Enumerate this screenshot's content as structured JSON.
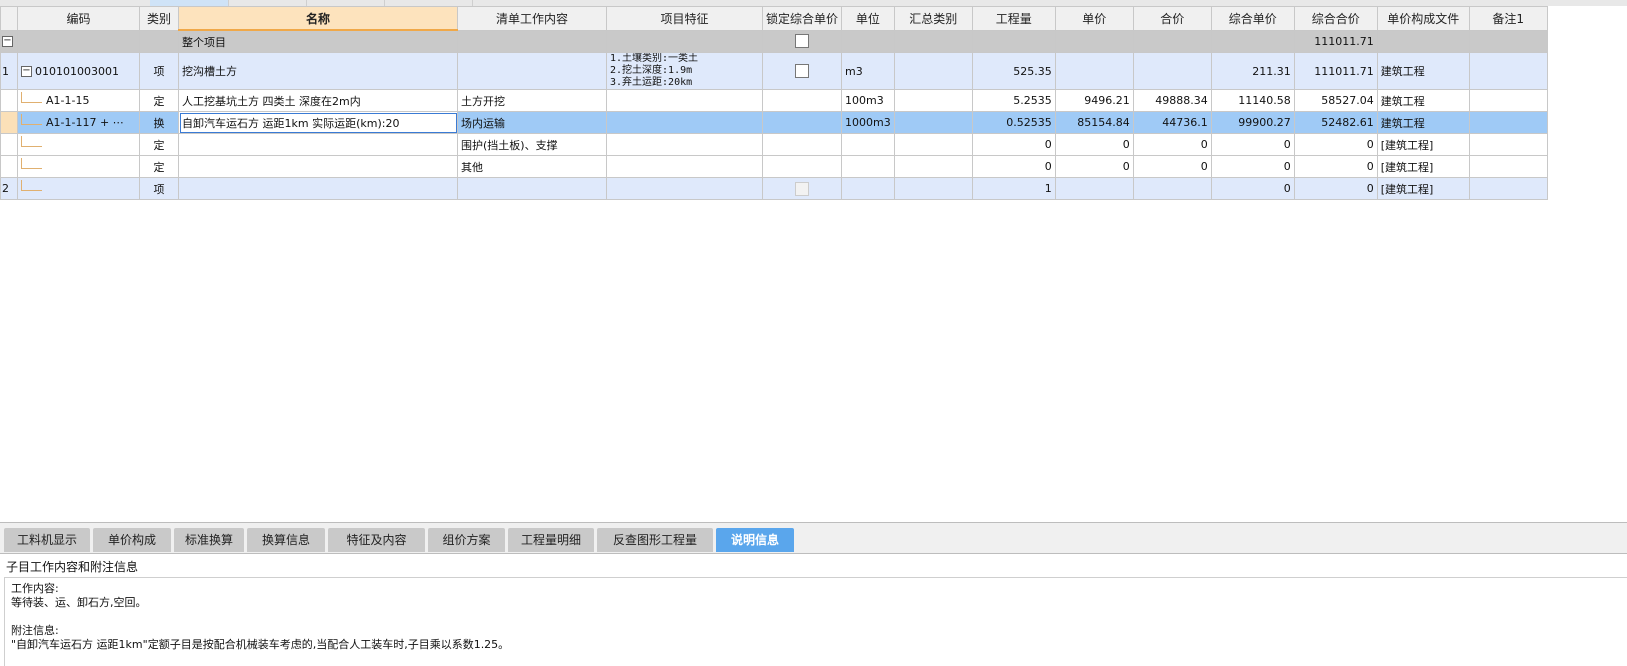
{
  "window": {
    "accent_color": "#5aa6ec",
    "selected_row_color": "#9fcaf6"
  },
  "table": {
    "headers": [
      "",
      "编码",
      "类别",
      "名称",
      "清单工作内容",
      "项目特征",
      "锁定综合单价",
      "单位",
      "汇总类别",
      "工程量",
      "单价",
      "合价",
      "综合单价",
      "综合合价",
      "单价构成文件",
      "备注1"
    ],
    "summary_row": {
      "name": "整个项目",
      "total": "111011.71"
    },
    "rows": [
      {
        "num": "1",
        "code": "010101003001",
        "type": "项",
        "name": "挖沟槽土方",
        "content": "",
        "feature_lines": [
          "1.土壤类别:一类土",
          "2.挖土深度:1.9m",
          "3.弃土运距:20km"
        ],
        "unit": "m3",
        "qty": "525.35",
        "price": "",
        "amount": "",
        "unit_price": "211.31",
        "total": "111011.71",
        "file": "建筑工程"
      },
      {
        "num": "",
        "code": "A1-1-15",
        "type": "定",
        "name": "人工挖基坑土方 四类土 深度在2m内",
        "content": "土方开挖",
        "unit": "100m3",
        "qty": "5.2535",
        "price": "9496.21",
        "amount": "49888.34",
        "unit_price": "11140.58",
        "total": "58527.04",
        "file": "建筑工程"
      },
      {
        "num": "",
        "code": "A1-1-117 + ⋯",
        "type": "换",
        "name": "自卸汽车运石方 运距1km  实际运距(km):20",
        "content": "场内运输",
        "unit": "1000m3",
        "qty": "0.52535",
        "price": "85154.84",
        "amount": "44736.1",
        "unit_price": "99900.27",
        "total": "52482.61",
        "file": "建筑工程"
      },
      {
        "num": "",
        "code": "",
        "type": "定",
        "name": "",
        "content": "围护(挡土板)、支撑",
        "unit": "",
        "qty": "0",
        "price": "0",
        "amount": "0",
        "unit_price": "0",
        "total": "0",
        "file": "[建筑工程]"
      },
      {
        "num": "",
        "code": "",
        "type": "定",
        "name": "",
        "content": "其他",
        "unit": "",
        "qty": "0",
        "price": "0",
        "amount": "0",
        "unit_price": "0",
        "total": "0",
        "file": "[建筑工程]"
      },
      {
        "num": "2",
        "code": "",
        "type": "项",
        "name": "",
        "content": "",
        "unit": "",
        "qty": "1",
        "price": "",
        "amount": "",
        "unit_price": "0",
        "total": "0",
        "file": "[建筑工程]"
      }
    ]
  },
  "tabs": [
    "工料机显示",
    "单价构成",
    "标准换算",
    "换算信息",
    "特征及内容",
    "组价方案",
    "工程量明细",
    "反查图形工程量",
    "说明信息"
  ],
  "active_tab": "说明信息",
  "info": {
    "title": "子目工作内容和附注信息",
    "work_label": "工作内容:",
    "work_text": "等待装、运、卸石方,空回。",
    "note_label": "附注信息:",
    "note_text": "\"自卸汽车运石方 运距1km\"定额子目是按配合机械装车考虑的,当配合人工装车时,子目乘以系数1.25。"
  }
}
